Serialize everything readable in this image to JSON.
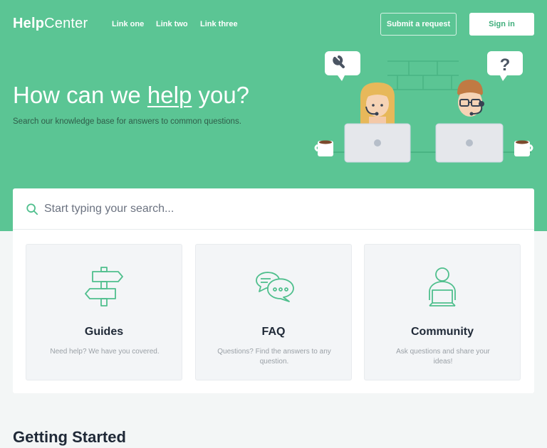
{
  "brand": {
    "logo_bold": "Help",
    "logo_light": "Center"
  },
  "nav": {
    "links": [
      "Link one",
      "Link two",
      "Link three"
    ],
    "submit_label": "Submit a request",
    "signin_label": "Sign in"
  },
  "hero": {
    "title_pre": "How can we ",
    "title_em": "help",
    "title_post": " you?",
    "subtitle": "Search our knowledge base for answers to common questions."
  },
  "search": {
    "placeholder": "Start typing your search..."
  },
  "cards": [
    {
      "title": "Guides",
      "description": "Need help? We have you covered.",
      "icon": "signpost-icon"
    },
    {
      "title": "FAQ",
      "description": "Questions? Find the answers to any question.",
      "icon": "chat-bubbles-icon"
    },
    {
      "title": "Community",
      "description": "Ask questions and share your ideas!",
      "icon": "person-laptop-icon"
    }
  ],
  "section": {
    "getting_started": "Getting Started"
  },
  "colors": {
    "primary": "#5bc594",
    "accent_text": "#3fae7b",
    "icon_stroke": "#4fbf8d",
    "card_bg": "#f3f5f7"
  }
}
